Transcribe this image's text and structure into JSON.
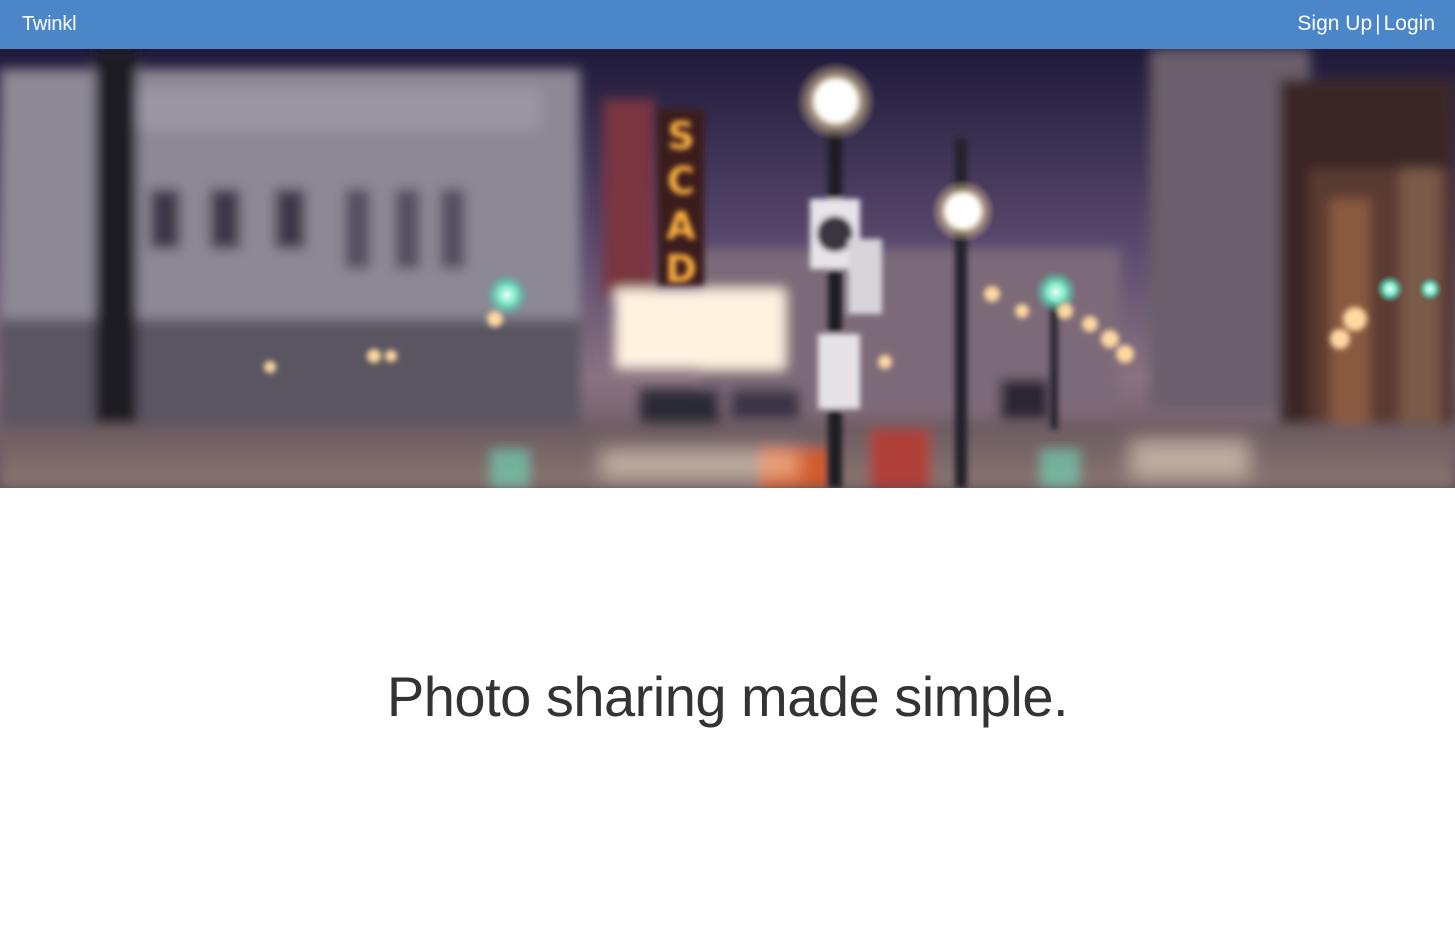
{
  "navbar": {
    "brand": "Twinkl",
    "signup_label": "Sign Up",
    "separator": "|",
    "login_label": "Login",
    "background_color": "#4a86c8",
    "text_color": "#ffffff"
  },
  "hero": {
    "sign_letters": [
      "S",
      "C",
      "A",
      "D"
    ]
  },
  "main": {
    "tagline": "Photo sharing made simple.",
    "tagline_color": "#333333"
  }
}
